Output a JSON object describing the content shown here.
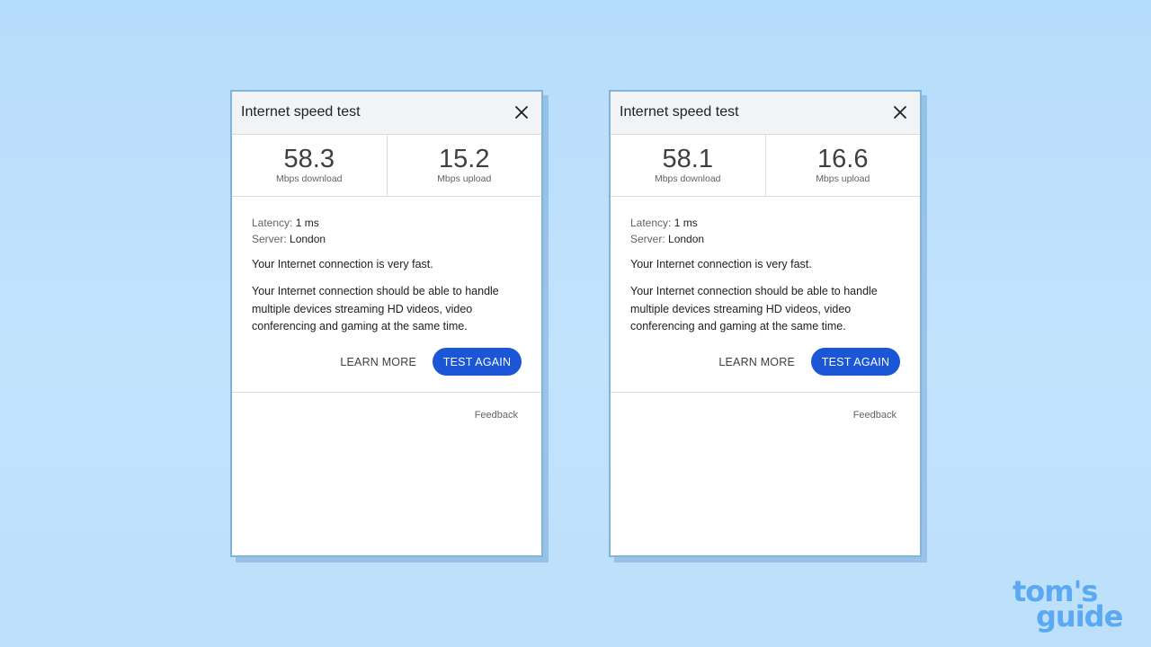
{
  "cards": [
    {
      "title": "Internet speed test",
      "download_value": "58.3",
      "download_unit": "Mbps download",
      "upload_value": "15.2",
      "upload_unit": "Mbps upload",
      "latency_label": "Latency:",
      "latency_value": "1 ms",
      "server_label": "Server:",
      "server_value": "London",
      "summary": "Your Internet connection is very fast.",
      "description": "Your Internet connection should be able to handle multiple devices streaming HD videos, video conferencing and gaming at the same time.",
      "learn_more_label": "LEARN MORE",
      "test_again_label": "TEST AGAIN",
      "feedback_label": "Feedback",
      "close_icon": "close-icon"
    },
    {
      "title": "Internet speed test",
      "download_value": "58.1",
      "download_unit": "Mbps download",
      "upload_value": "16.6",
      "upload_unit": "Mbps upload",
      "latency_label": "Latency:",
      "latency_value": "1 ms",
      "server_label": "Server:",
      "server_value": "London",
      "summary": "Your Internet connection is very fast.",
      "description": "Your Internet connection should be able to handle multiple devices streaming HD videos, video conferencing and gaming at the same time.",
      "learn_more_label": "LEARN MORE",
      "test_again_label": "TEST AGAIN",
      "feedback_label": "Feedback",
      "close_icon": "close-icon"
    }
  ],
  "logo": {
    "line1": "tom's",
    "line2": "guide",
    "color": "#5aa9f2"
  },
  "colors": {
    "accent": "#1a56d6",
    "background": "#bcdffb",
    "card_border": "#7fb5db"
  }
}
